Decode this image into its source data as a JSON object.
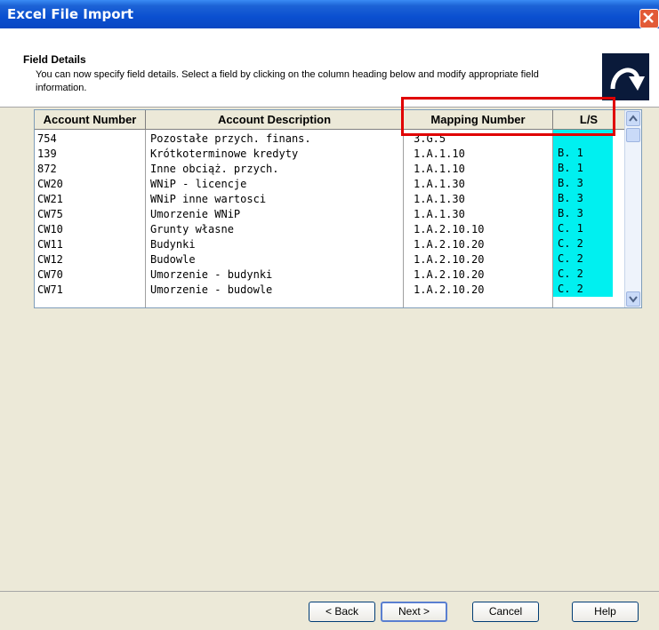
{
  "window": {
    "title": "Excel File Import"
  },
  "header": {
    "title": "Field Details",
    "description": "You can now specify field details. Select a field by clicking on the column heading below and modify appropriate field information."
  },
  "grid": {
    "columns": [
      "Account Number",
      "Account Description",
      "Mapping Number",
      "L/S"
    ],
    "rows": [
      [
        "754",
        "Pozostałe przych. finans.",
        "3.G.5",
        ""
      ],
      [
        "139",
        "Krótkoterminowe kredyty",
        "1.A.1.10",
        "B. 1"
      ],
      [
        "872",
        "Inne obciąż. przych.",
        "1.A.1.10",
        "B. 1"
      ],
      [
        "CW20",
        "WNiP - licencje",
        "1.A.1.30",
        "B. 3"
      ],
      [
        "CW21",
        "WNiP inne wartosci",
        "1.A.1.30",
        "B. 3"
      ],
      [
        "CW75",
        "Umorzenie WNiP",
        "1.A.1.30",
        "B. 3"
      ],
      [
        "CW10",
        "Grunty własne",
        "1.A.2.10.10",
        "C. 1"
      ],
      [
        "CW11",
        "Budynki",
        "1.A.2.10.20",
        "C. 2"
      ],
      [
        "CW12",
        "Budowle",
        "1.A.2.10.20",
        "C. 2"
      ],
      [
        "CW70",
        "Umorzenie - budynki",
        "1.A.2.10.20",
        "C. 2"
      ],
      [
        "CW71",
        "Umorzenie - budowle",
        "1.A.2.10.20",
        "C. 2"
      ]
    ],
    "highlight_color": "#00f0f0",
    "annotation_color": "#e00000"
  },
  "buttons": {
    "back": "< Back",
    "next": "Next >",
    "cancel": "Cancel",
    "help": "Help"
  }
}
